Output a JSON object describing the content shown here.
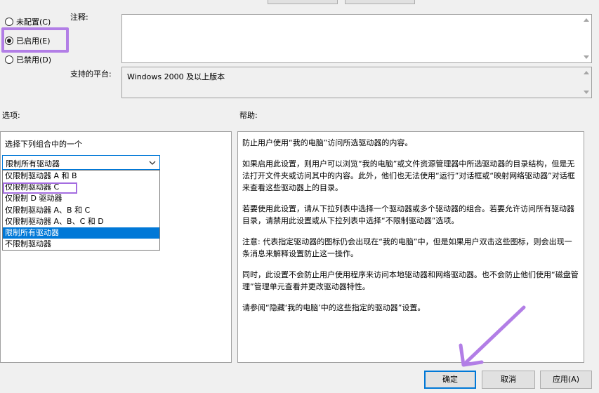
{
  "state": {
    "unconfigured": "未配置(C)",
    "enabled": "已启用(E)",
    "disabled": "已禁用(D)",
    "selected": "enabled"
  },
  "comment": {
    "label": "注释:",
    "value": ""
  },
  "platform": {
    "label": "支持的平台:",
    "value": "Windows 2000 及以上版本"
  },
  "options": {
    "heading": "选项:",
    "combo_label": "选择下列组合中的一个",
    "selected": "限制所有驱动器",
    "items": [
      "仅限制驱动器 A 和 B",
      "仅限制驱动器 C",
      "仅限制 D 驱动器",
      "仅限制驱动器 A、B 和 C",
      "仅限制驱动器 A、B、C 和 D",
      "限制所有驱动器",
      "不限制驱动器"
    ],
    "highlighted_index": 5
  },
  "help": {
    "heading": "帮助:",
    "paragraphs": [
      "防止用户使用“我的电脑”访问所选驱动器的内容。",
      "如果启用此设置，则用户可以浏览“我的电脑”或文件资源管理器中所选驱动器的目录结构，但是无法打开文件夹或访问其中的内容。此外，他们也无法使用“运行”对话框或“映射网络驱动器”对话框来查看这些驱动器上的目录。",
      "若要使用此设置，请从下拉列表中选择一个驱动器或多个驱动器的组合。若要允许访问所有驱动器目录，请禁用此设置或从下拉列表中选择“不限制驱动器”选项。",
      "注意: 代表指定驱动器的图标仍会出现在“我的电脑”中，但是如果用户双击这些图标，则会出现一条消息来解释设置防止这一操作。",
      " 同时，此设置不会防止用户使用程序来访问本地驱动器和网络驱动器。也不会防止他们使用“磁盘管理”管理单元查看并更改驱动器特性。",
      "请参阅“隐藏‘我的电脑’中的这些指定的驱动器”设置。"
    ]
  },
  "buttons": {
    "ok": "确定",
    "cancel": "取消",
    "apply": "应用(A)"
  },
  "colors": {
    "annotation": "#b27ee6",
    "selection": "#0078d7"
  },
  "icons": [
    "chevron-down-icon",
    "scroll-up-icon",
    "scroll-down-icon",
    "arrow-pointer-icon"
  ]
}
